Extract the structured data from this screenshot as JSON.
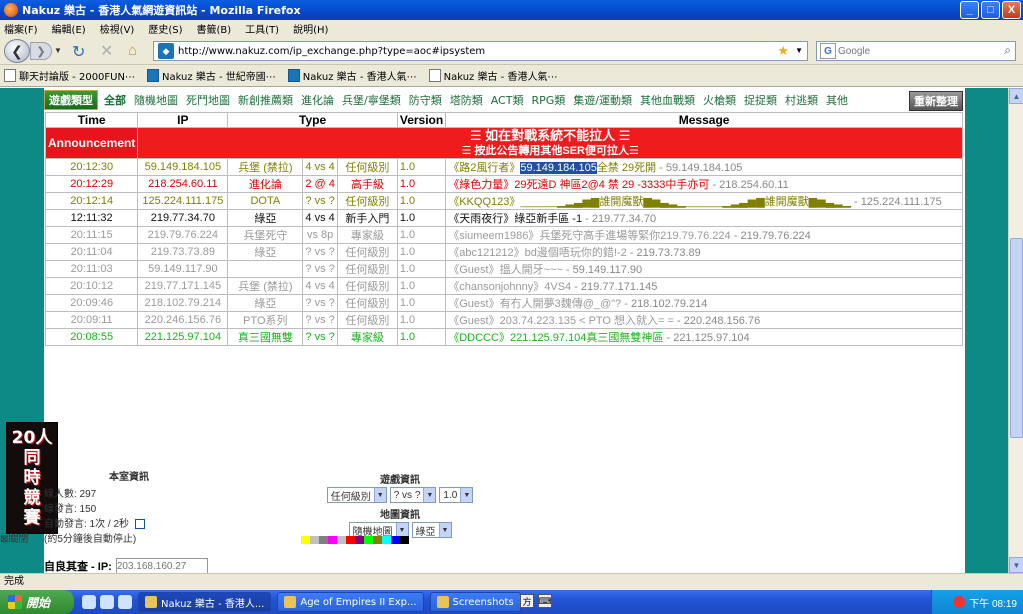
{
  "window": {
    "title": "Nakuz 樂古 - 香港人氣網遊資訊站 - Mozilla Firefox",
    "controls": [
      "_",
      "□",
      "X"
    ]
  },
  "menu": [
    "檔案(F)",
    "編輯(E)",
    "檢視(V)",
    "歷史(S)",
    "書籤(B)",
    "工具(T)",
    "說明(H)"
  ],
  "nav": {
    "url": "http://www.nakuz.com/ip_exchange.php?type=aoc#ipsystem",
    "search_placeholder": "Google"
  },
  "bookmarks": [
    "聊天討論版 - 2000FUN⋯",
    "Nakuz 樂古 - 世紀帝國⋯",
    "Nakuz 樂古 - 香港人氣⋯",
    "Nakuz 樂古 - 香港人氣⋯"
  ],
  "categories": {
    "logo": "遊戲類型",
    "items": [
      "全部",
      "隨機地圖",
      "死鬥地圖",
      "新創推薦類",
      "進化論",
      "兵堡/寧堡類",
      "防守類",
      "塔防類",
      "ACT類",
      "RPG類",
      "集遊/運動類",
      "其他血戰類",
      "火槍類",
      "捉捉類",
      "村逃類",
      "其他"
    ],
    "refresh": "重新整理"
  },
  "table": {
    "headers": [
      "Time",
      "IP",
      "Type",
      "Version",
      "Message"
    ],
    "announcement": {
      "label": "Announcement",
      "line1": "☰ 如在對戰系統不能拉人 ☰",
      "line2": "☰ 按此公告轉用其他SER便可拉人☰"
    },
    "rows": [
      {
        "time": "20:12:30",
        "ip": "59.149.184.105",
        "type": "兵堡 (禁拉)",
        "mode": "4 vs 4",
        "level": "任何級別",
        "ver": "1.0",
        "msg_name": "《路2風行者》",
        "msg_text": "59.149.184.105",
        "msg_text2": "全禁 29死開",
        "msg_tail": " - 59.149.184.105",
        "color": "olive"
      },
      {
        "time": "20:12:29",
        "ip": "218.254.60.11",
        "type": "進化論",
        "mode": "2 @ 4",
        "level": "高手級",
        "ver": "1.0",
        "msg_name": "《綠色力量》",
        "msg_text": "29死遠D 神區2@4 禁 29 -3333中手亦可",
        "msg_text2": "",
        "msg_tail": " - 218.254.60.11",
        "color": "red"
      },
      {
        "time": "20:12:14",
        "ip": "125.224.111.175",
        "type": "DOTA",
        "mode": "? vs ?",
        "level": "任何級別",
        "ver": "1.0",
        "msg_name": "《KKQQ123》",
        "msg_text": "______▁▂▃▅▆誰開魔獸▆▅▃▂▁______▁▂▃▅▆誰開魔獸▆▅▃▂▁",
        "msg_text2": "",
        "msg_tail": " - 125.224.111.175",
        "color": "olive"
      },
      {
        "time": "12:11:32",
        "ip": "219.77.34.70",
        "type": "綠亞",
        "mode": "4 vs 4",
        "level": "新手入門",
        "ver": "1.0",
        "msg_name": "《天雨夜行》",
        "msg_text": "綠亞新手區 -1",
        "msg_text2": "",
        "msg_tail": " - 219.77.34.70",
        "color": "dark"
      },
      {
        "time": "20:11:15",
        "ip": "219.79.76.224",
        "type": "兵堡死守",
        "mode": "vs 8p",
        "level": "專家級",
        "ver": "1.0",
        "msg_name": "《siumeem1986》",
        "msg_text": "兵堡死守高手進場等緊你219.79.76.224",
        "msg_text2": "",
        "msg_tail": " - 219.79.76.224",
        "color": "grey"
      },
      {
        "time": "20:11:04",
        "ip": "219.73.73.89",
        "type": "綠亞",
        "mode": "? vs ?",
        "level": "任何級別",
        "ver": "1.0",
        "msg_name": "《abc121212》",
        "msg_text": "bd邊個唔玩你的錯!-2",
        "msg_text2": "",
        "msg_tail": " - 219.73.73.89",
        "color": "grey"
      },
      {
        "time": "20:11:03",
        "ip": "59.149.117.90",
        "type": "",
        "mode": "? vs ?",
        "level": "任何級別",
        "ver": "1.0",
        "msg_name": "《Guest》",
        "msg_text": "搵人開牙~~~",
        "msg_text2": "",
        "msg_tail": " - 59.149.117.90",
        "color": "grey"
      },
      {
        "time": "20:10:12",
        "ip": "219.77.171.145",
        "type": "兵堡 (禁拉)",
        "mode": "4 vs 4",
        "level": "任何級別",
        "ver": "1.0",
        "msg_name": "《chansonjohnny》",
        "msg_text": "4VS4",
        "msg_text2": "",
        "msg_tail": " - 219.77.171.145",
        "color": "grey"
      },
      {
        "time": "20:09:46",
        "ip": "218.102.79.214",
        "type": "綠亞",
        "mode": "? vs ?",
        "level": "任何級別",
        "ver": "1.0",
        "msg_name": "《Guest》",
        "msg_text": "有冇人開夢3魏傳@_@\"?",
        "msg_text2": "",
        "msg_tail": " - 218.102.79.214",
        "color": "grey"
      },
      {
        "time": "20:09:11",
        "ip": "220.246.156.76",
        "type": "PTO系列",
        "mode": "? vs ?",
        "level": "任何級別",
        "ver": "1.0",
        "msg_name": "《Guest》",
        "msg_text": "203.74.223.135 < PTO 想入就入= = ",
        "msg_text2": "",
        "msg_tail": " - 220.248.156.76",
        "color": "grey"
      },
      {
        "time": "20:08:55",
        "ip": "221.125.97.104",
        "type": "真三國無雙",
        "mode": "? vs ?",
        "level": "專家級",
        "ver": "1.0",
        "msg_name": "《DDCCC》",
        "msg_text": "221.125.97.104真三國無雙神區",
        "msg_text2": "",
        "msg_tail": " - 221.125.97.104",
        "color": "green"
      }
    ]
  },
  "ad": [
    "20人",
    "同",
    "時",
    "競",
    "賽"
  ],
  "ad_close": "⊠關閉",
  "room_info": {
    "title": "本室資訊",
    "users": "線人數: 297",
    "msgs": "線發言: 150",
    "auto": "自動發言: 1次 / 2秒",
    "note": "(約5分鐘後自動停止)",
    "ip_label": "自良其查 - IP:",
    "ip_value": "203.168.160.27"
  },
  "game_info": {
    "title": "遊戲資訊",
    "sel_level": "任何級別",
    "sel_mode": "? vs ?",
    "sel_ver": "1.0",
    "map_title": "地圖資訊",
    "sel_map": "隨機地圖",
    "sel_map2": "綠亞"
  },
  "palette": [
    "#ffff00",
    "#c0c0c0",
    "#808080",
    "#ff00ff",
    "#c0c0c0",
    "#ff0000",
    "#800080",
    "#00ff00",
    "#808000",
    "#00ffff",
    "#0000ff",
    "#000000"
  ],
  "status": "完成",
  "taskbar": {
    "start": "開始",
    "tasks": [
      "Nakuz 樂古 - 香港人...",
      "Age of Empires II Exp...",
      "Screenshots"
    ],
    "time": "下午 08:19"
  }
}
